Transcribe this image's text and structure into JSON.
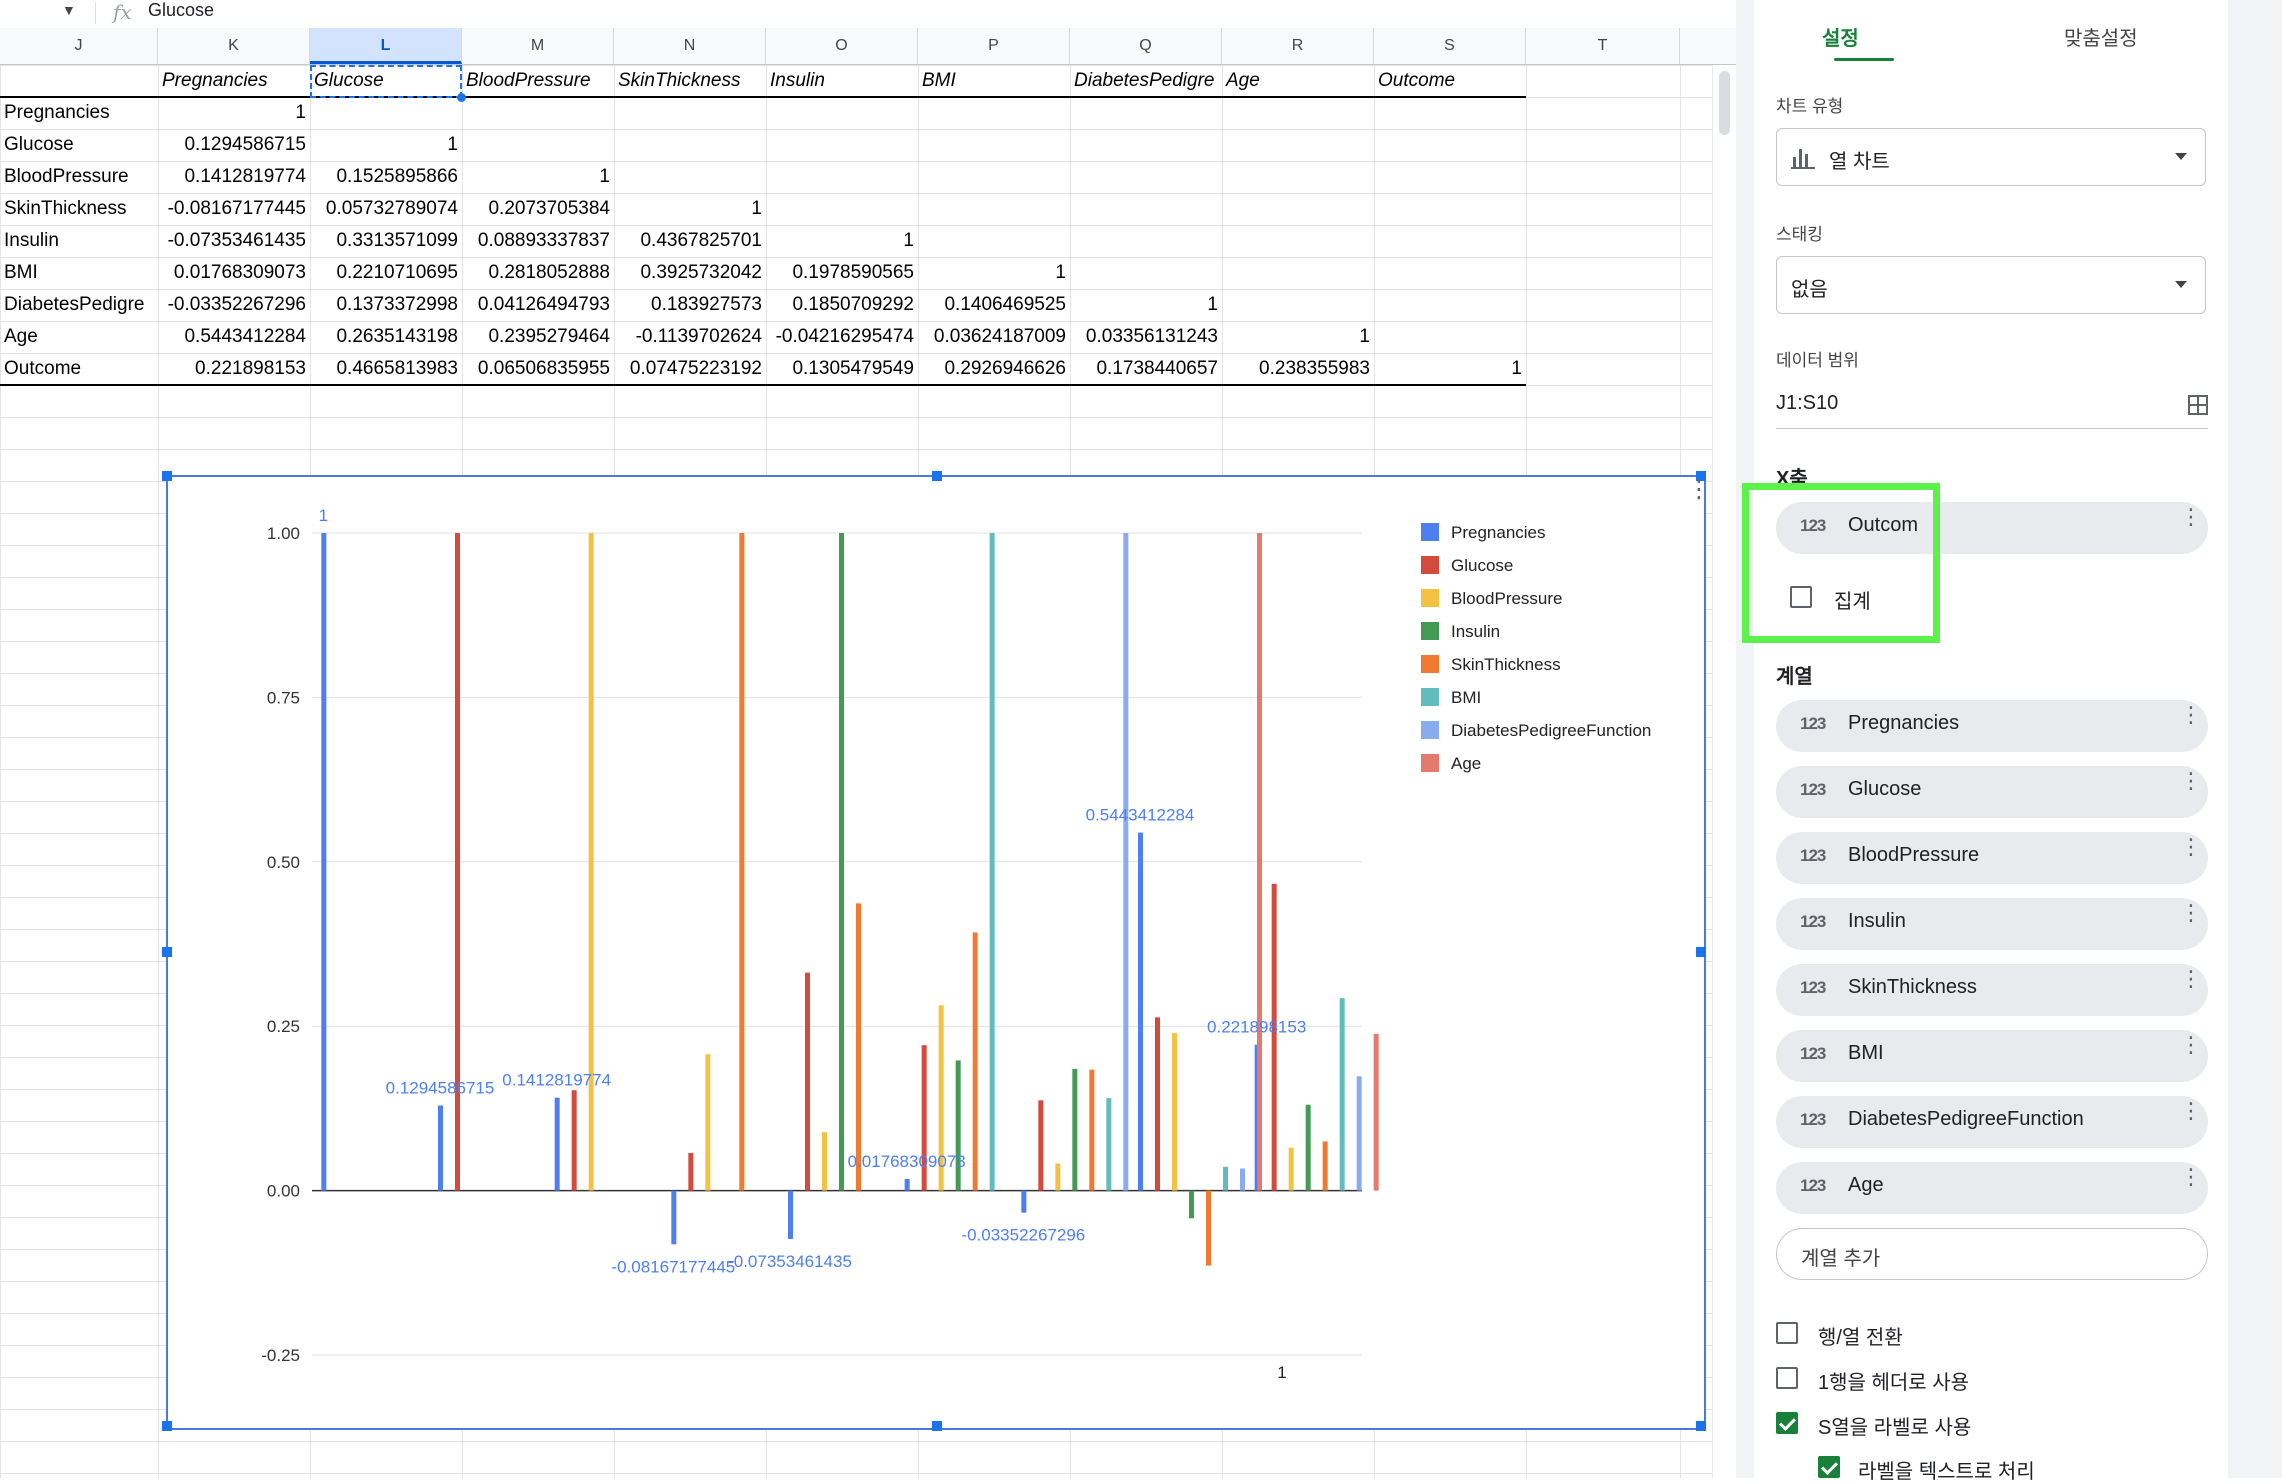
{
  "formula_bar": {
    "fx_label": "fx",
    "content": "Glucose"
  },
  "columns": [
    "J",
    "K",
    "L",
    "M",
    "N",
    "O",
    "P",
    "Q",
    "R",
    "S",
    "T"
  ],
  "table": {
    "headers": [
      "Pregnancies",
      "Glucose",
      "BloodPressure",
      "SkinThickness",
      "Insulin",
      "BMI",
      "DiabetesPedigre",
      "Age",
      "Outcome"
    ],
    "rows": [
      {
        "label": "Pregnancies",
        "values": [
          "1",
          "",
          "",
          "",
          "",
          "",
          "",
          "",
          ""
        ]
      },
      {
        "label": "Glucose",
        "values": [
          "0.1294586715",
          "1",
          "",
          "",
          "",
          "",
          "",
          "",
          ""
        ]
      },
      {
        "label": "BloodPressure",
        "values": [
          "0.1412819774",
          "0.1525895866",
          "1",
          "",
          "",
          "",
          "",
          "",
          ""
        ]
      },
      {
        "label": "SkinThickness",
        "values": [
          "-0.08167177445",
          "0.05732789074",
          "0.2073705384",
          "1",
          "",
          "",
          "",
          "",
          ""
        ]
      },
      {
        "label": "Insulin",
        "values": [
          "-0.07353461435",
          "0.3313571099",
          "0.08893337837",
          "0.4367825701",
          "1",
          "",
          "",
          "",
          ""
        ]
      },
      {
        "label": "BMI",
        "values": [
          "0.01768309073",
          "0.2210710695",
          "0.2818052888",
          "0.3925732042",
          "0.1978590565",
          "1",
          "",
          "",
          ""
        ]
      },
      {
        "label": "DiabetesPedigre",
        "values": [
          "-0.03352267296",
          "0.1373372998",
          "0.04126494793",
          "0.183927573",
          "0.1850709292",
          "0.1406469525",
          "1",
          "",
          ""
        ]
      },
      {
        "label": "Age",
        "values": [
          "0.5443412284",
          "0.2635143198",
          "0.2395279464",
          "-0.1139702624",
          "-0.04216295474",
          "0.03624187009",
          "0.03356131243",
          "1",
          ""
        ]
      },
      {
        "label": "Outcome",
        "values": [
          "0.221898153",
          "0.4665813983",
          "0.06506835955",
          "0.07475223192",
          "0.1305479549",
          "0.2926946626",
          "0.1738440657",
          "0.238355983",
          "1"
        ]
      }
    ]
  },
  "chart_data": {
    "type": "bar",
    "categories": [
      "",
      "",
      "",
      "",
      "",
      "",
      "",
      "",
      ""
    ],
    "bottom_label": "1",
    "ylim": [
      -0.25,
      1.0
    ],
    "yticks": [
      "1.00",
      "0.75",
      "0.50",
      "0.25",
      "0.00",
      "-0.25"
    ],
    "legend_position": "right",
    "series": [
      {
        "name": "Pregnancies",
        "color": "#4e7ff0",
        "values": [
          1,
          0.1294586715,
          0.1412819774,
          -0.08167177445,
          -0.07353461435,
          0.01768309073,
          -0.03352267296,
          0.5443412284,
          0.221898153
        ]
      },
      {
        "name": "Glucose",
        "color": "#d44a3c",
        "values": [
          null,
          1,
          0.1525895866,
          0.05732789074,
          0.3313571099,
          0.2210710695,
          0.1373372998,
          0.2635143198,
          0.4665813983
        ]
      },
      {
        "name": "BloodPressure",
        "color": "#f4c243",
        "values": [
          null,
          null,
          1,
          0.2073705384,
          0.08893337837,
          0.2818052888,
          0.04126494793,
          0.2395279464,
          0.06506835955
        ]
      },
      {
        "name": "Insulin",
        "color": "#439a55",
        "values": [
          null,
          null,
          null,
          null,
          1,
          0.1978590565,
          0.1850709292,
          -0.04216295474,
          0.1305479549
        ]
      },
      {
        "name": "SkinThickness",
        "color": "#f07a2f",
        "values": [
          null,
          null,
          null,
          1,
          0.4367825701,
          0.3925732042,
          0.183927573,
          -0.1139702624,
          0.07475223192
        ]
      },
      {
        "name": "BMI",
        "color": "#61bcbe",
        "values": [
          null,
          null,
          null,
          null,
          null,
          1,
          0.1406469525,
          0.03624187009,
          0.2926946626
        ]
      },
      {
        "name": "DiabetesPedigreeFunction",
        "color": "#89abf0",
        "values": [
          null,
          null,
          null,
          null,
          null,
          null,
          1,
          0.03356131243,
          0.1738440657
        ]
      },
      {
        "name": "Age",
        "color": "#e47a6e",
        "values": [
          null,
          null,
          null,
          null,
          null,
          null,
          null,
          1,
          0.238355983
        ]
      }
    ],
    "data_labels": [
      {
        "group": 0,
        "text": "1"
      },
      {
        "group": 1,
        "text": "0.1294586715"
      },
      {
        "group": 2,
        "text": "0.1412819774"
      },
      {
        "group": 3,
        "text": "-0.08167177445"
      },
      {
        "group": 4,
        "text": "-0.07353461435"
      },
      {
        "group": 5,
        "text": "0.01768309073"
      },
      {
        "group": 6,
        "text": "-0.03352267296"
      },
      {
        "group": 7,
        "text": "0.5443412284"
      },
      {
        "group": 8,
        "text": "0.221898153"
      }
    ]
  },
  "panel": {
    "tabs": [
      "설정",
      "맞춤설정"
    ],
    "chart_type_label": "차트 유형",
    "chart_type_value": "열 차트",
    "stacking_label": "스태킹",
    "stacking_value": "없음",
    "data_range_label": "데이터 범위",
    "data_range_value": "J1:S10",
    "x_axis_label": "X축",
    "x_axis_chip": "Outcom",
    "aggregate_label": "집계",
    "series_label": "계열",
    "series_chips": [
      "Pregnancies",
      "Glucose",
      "BloodPressure",
      "Insulin",
      "SkinThickness",
      "BMI",
      "DiabetesPedigreeFunction",
      "Age"
    ],
    "chip_icon": "123",
    "add_series": "계열 추가",
    "switch_rows_cols": "행/열 전환",
    "use_row1_header": "1행을 헤더로 사용",
    "use_col_s_labels": "S열을 라벨로 사용",
    "treat_labels_text": "라벨을 텍스트로 처리"
  }
}
